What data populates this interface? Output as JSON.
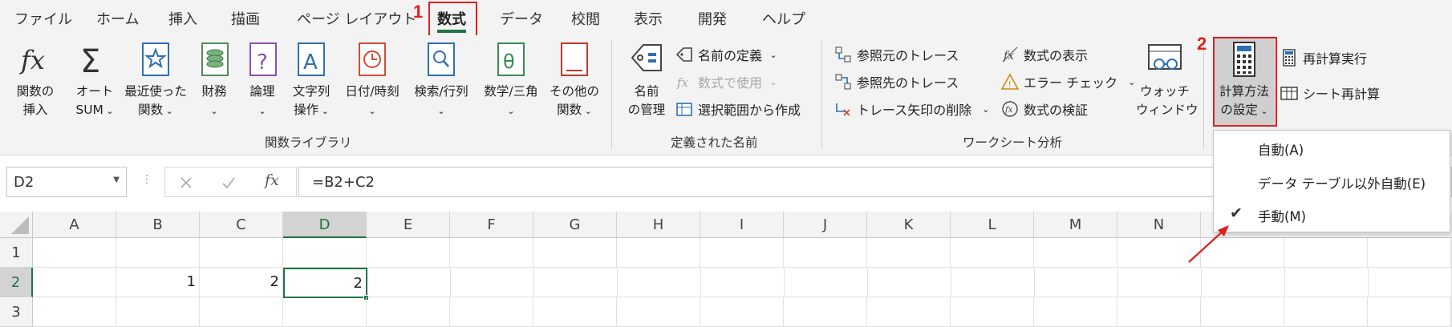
{
  "menu": {
    "tabs": [
      "ファイル",
      "ホーム",
      "挿入",
      "描画",
      "ページ レイアウト",
      "数式",
      "データ",
      "校閲",
      "表示",
      "開発",
      "ヘルプ"
    ],
    "active_tab": "数式"
  },
  "annotations": {
    "step1": "1",
    "step2": "2",
    "color": "#e01e1e"
  },
  "ribbon": {
    "function_library": {
      "insert_function": "関数の\n挿入",
      "autosum": "オート\nSUM",
      "recent": "最近使った\n関数",
      "financial": "財務",
      "logical": "論理",
      "text": "文字列\n操作",
      "datetime": "日付/時刻",
      "lookup": "検索/行列",
      "math": "数学/三角",
      "more": "その他の\n関数",
      "group_label": "関数ライブラリ"
    },
    "defined_names": {
      "name_manager": "名前\nの管理",
      "define_name": "名前の定義",
      "use_in_formula": "数式で使用",
      "create_from_selection": "選択範囲から作成",
      "group_label": "定義された名前"
    },
    "formula_auditing": {
      "trace_precedents": "参照元のトレース",
      "trace_dependents": "参照先のトレース",
      "remove_arrows": "トレース矢印の削除",
      "show_formulas": "数式の表示",
      "error_checking": "エラー チェック",
      "evaluate_formula": "数式の検証",
      "watch_window": "ウォッチ\nウィンドウ",
      "group_label": "ワークシート分析"
    },
    "calculation": {
      "calc_options": "計算方法\nの設定",
      "calc_now": "再計算実行",
      "calc_sheet": "シート再計算"
    }
  },
  "formula_bar": {
    "name_box": "D2",
    "formula": "=B2+C2"
  },
  "sheet": {
    "columns": [
      "A",
      "B",
      "C",
      "D",
      "E",
      "F",
      "G",
      "H",
      "I",
      "J",
      "K",
      "L",
      "M",
      "N"
    ],
    "rows": [
      "1",
      "2",
      "3"
    ],
    "cells": {
      "B2": "1",
      "C2": "2",
      "D2": "2"
    },
    "selected_cell": "D2"
  },
  "calc_menu": {
    "items": [
      "自動(A)",
      "データ テーブル以外自動(E)",
      "手動(M)"
    ],
    "checked": "手動(M)",
    "check_mark": "✔"
  },
  "colors": {
    "excel_green": "#217346",
    "annotation_red": "#e01e1e"
  }
}
